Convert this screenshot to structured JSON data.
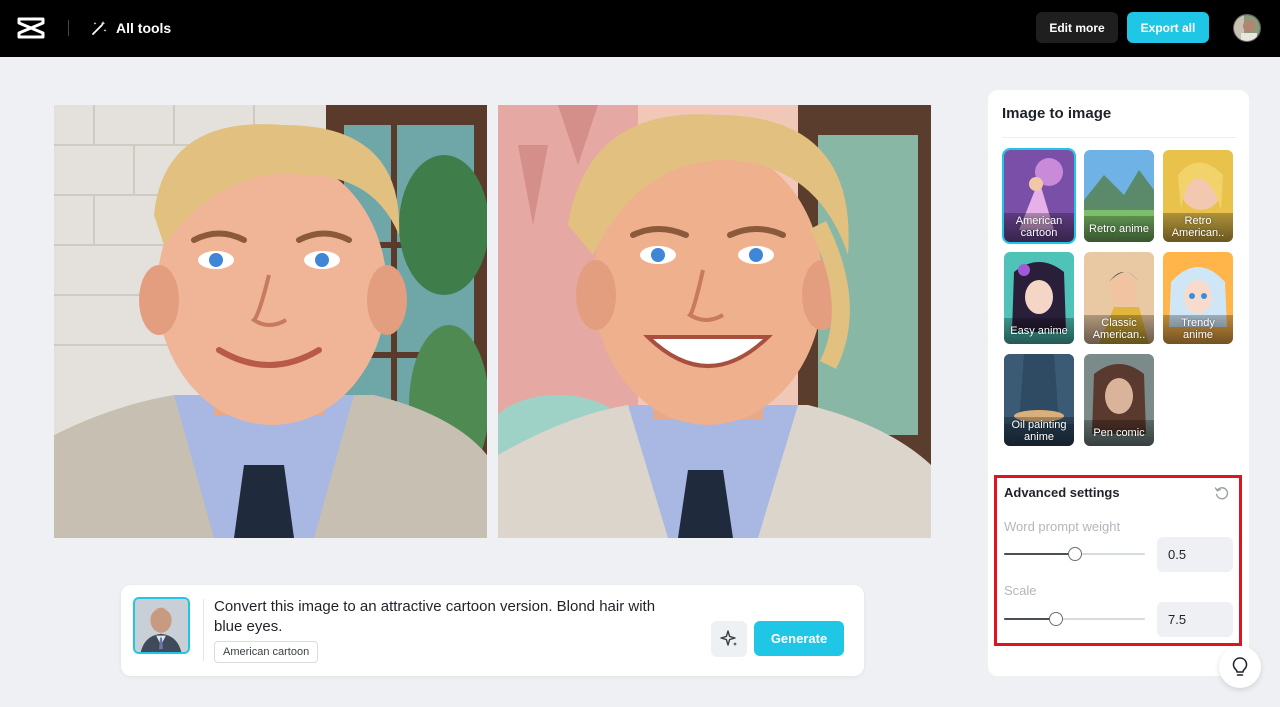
{
  "header": {
    "all_tools_label": "All tools",
    "edit_more_label": "Edit more",
    "export_all_label": "Export all"
  },
  "prompt": {
    "text": "Convert this image to an attractive cartoon version. Blond hair with blue eyes.",
    "style_tag": "American cartoon",
    "generate_label": "Generate"
  },
  "panel": {
    "title": "Image to image",
    "styles": [
      {
        "label": "American cartoon",
        "selected": true
      },
      {
        "label": "Retro anime",
        "selected": false
      },
      {
        "label": "Retro American..",
        "selected": false
      },
      {
        "label": "Easy anime",
        "selected": false
      },
      {
        "label": "Classic American..",
        "selected": false
      },
      {
        "label": "Trendy anime",
        "selected": false
      },
      {
        "label": "Oil painting anime",
        "selected": false
      },
      {
        "label": "Pen comic",
        "selected": false
      }
    ],
    "advanced": {
      "title": "Advanced settings",
      "word_prompt_weight_label": "Word prompt weight",
      "word_prompt_weight_value": "0.5",
      "word_prompt_weight_fraction": 0.5,
      "scale_label": "Scale",
      "scale_value": "7.5",
      "scale_fraction": 0.37
    }
  },
  "colors": {
    "accent": "#1fc6e6",
    "highlight_border": "#e0141e",
    "topbar": "#000000"
  },
  "icons": [
    "capcut-logo-icon",
    "magic-wand-icon",
    "sparkle-icon",
    "reset-icon",
    "lightbulb-icon"
  ]
}
